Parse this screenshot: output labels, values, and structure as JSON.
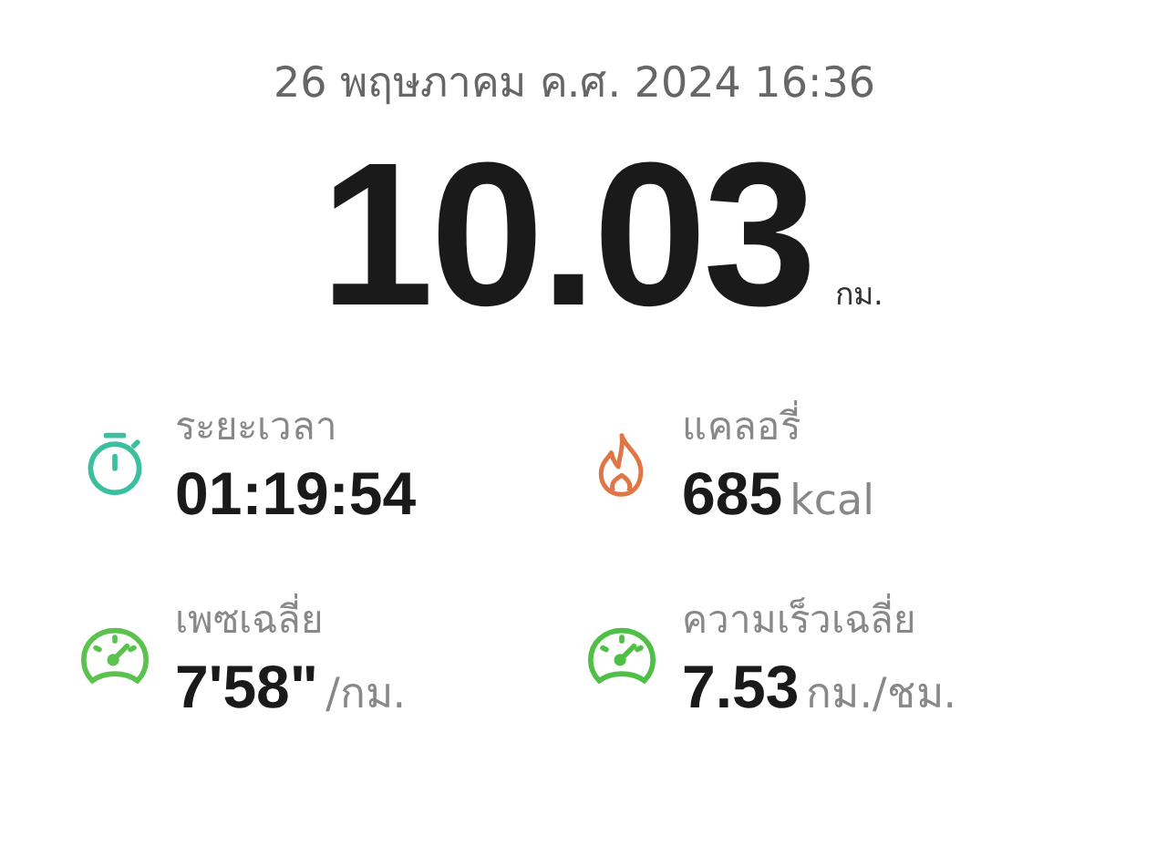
{
  "date": "26 พฤษภาคม ค.ศ. 2024 16:36",
  "distance": {
    "value": "10.03",
    "unit": "กม."
  },
  "stats": [
    {
      "kind": "timer",
      "color": "#3cbf9e",
      "label": "ระยะเวลา",
      "value": "01:19:54"
    },
    {
      "kind": "flame",
      "color": "#e07545",
      "label": "แคลอรี่",
      "value": "685",
      "unit": "kcal"
    },
    {
      "kind": "gauge",
      "color": "#5cc24f",
      "label": "เพซเฉลี่ย",
      "value": "7'58\"",
      "unit": "/กม."
    },
    {
      "kind": "gauge",
      "color": "#4fbf48",
      "label": "ความเร็วเฉลี่ย",
      "value": "7.53",
      "unit": "กม./ชม."
    }
  ]
}
